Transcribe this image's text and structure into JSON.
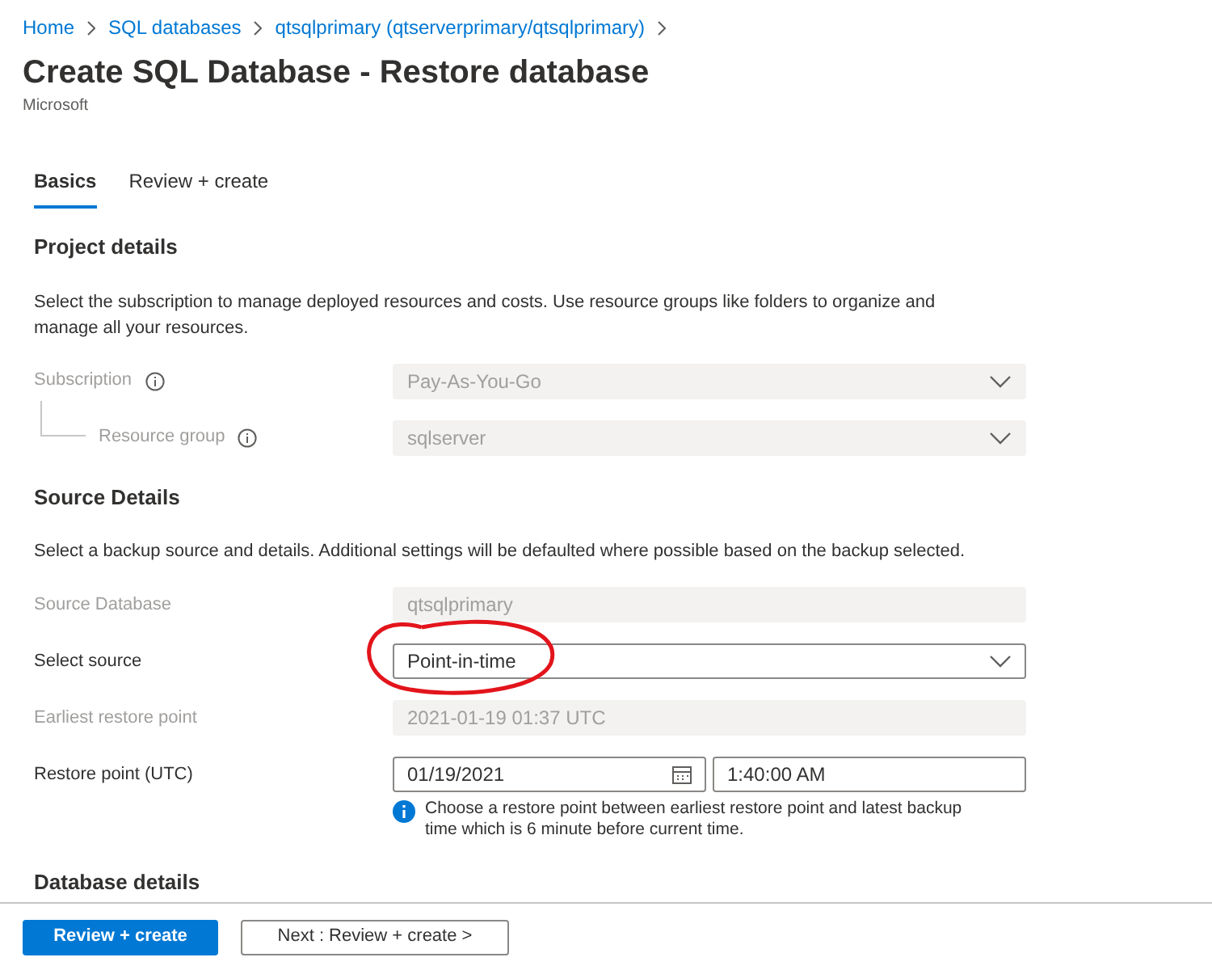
{
  "breadcrumb": [
    "Home",
    "SQL databases",
    "qtsqlprimary (qtserverprimary/qtsqlprimary)"
  ],
  "title": "Create SQL Database - Restore database",
  "publisher": "Microsoft",
  "tabs": [
    {
      "label": "Basics",
      "selected": true
    },
    {
      "label": "Review + create",
      "selected": false
    }
  ],
  "sections": [
    {
      "heading": "Project details",
      "description": "Select the subscription to manage deployed resources and costs. Use resource groups like folders to organize and manage all your resources.",
      "fields": [
        {
          "label": "Subscription",
          "info": true,
          "kind": "dropdown",
          "value": "Pay-As-You-Go",
          "disabled": true,
          "children": [
            {
              "label": "Resource group",
              "info": true,
              "kind": "dropdown",
              "value": "sqlserver",
              "disabled": true
            }
          ]
        }
      ]
    },
    {
      "heading": "Source Details",
      "description": "Select a backup source and details. Additional settings will be defaulted where possible based on the backup selected.",
      "fields": [
        {
          "label": "Source Database",
          "kind": "text",
          "value": "qtsqlprimary",
          "disabled": true
        },
        {
          "label": "Select source",
          "kind": "dropdown",
          "value": "Point-in-time",
          "disabled": false,
          "circled": true
        },
        {
          "label": "Earliest restore point",
          "kind": "text",
          "value": "2021-01-19 01:37 UTC",
          "disabled": true
        },
        {
          "label": "Restore point (UTC)",
          "kind": "datetime",
          "value": "01/19/2021",
          "time": "1:40:00 AM",
          "disabled": false,
          "note": "Choose a restore point between earliest restore point and latest backup time which is 6 minute before current time."
        }
      ]
    },
    {
      "heading": "Database details"
    }
  ],
  "footer": {
    "primary": "Review + create",
    "secondary": "Next : Review + create >"
  }
}
